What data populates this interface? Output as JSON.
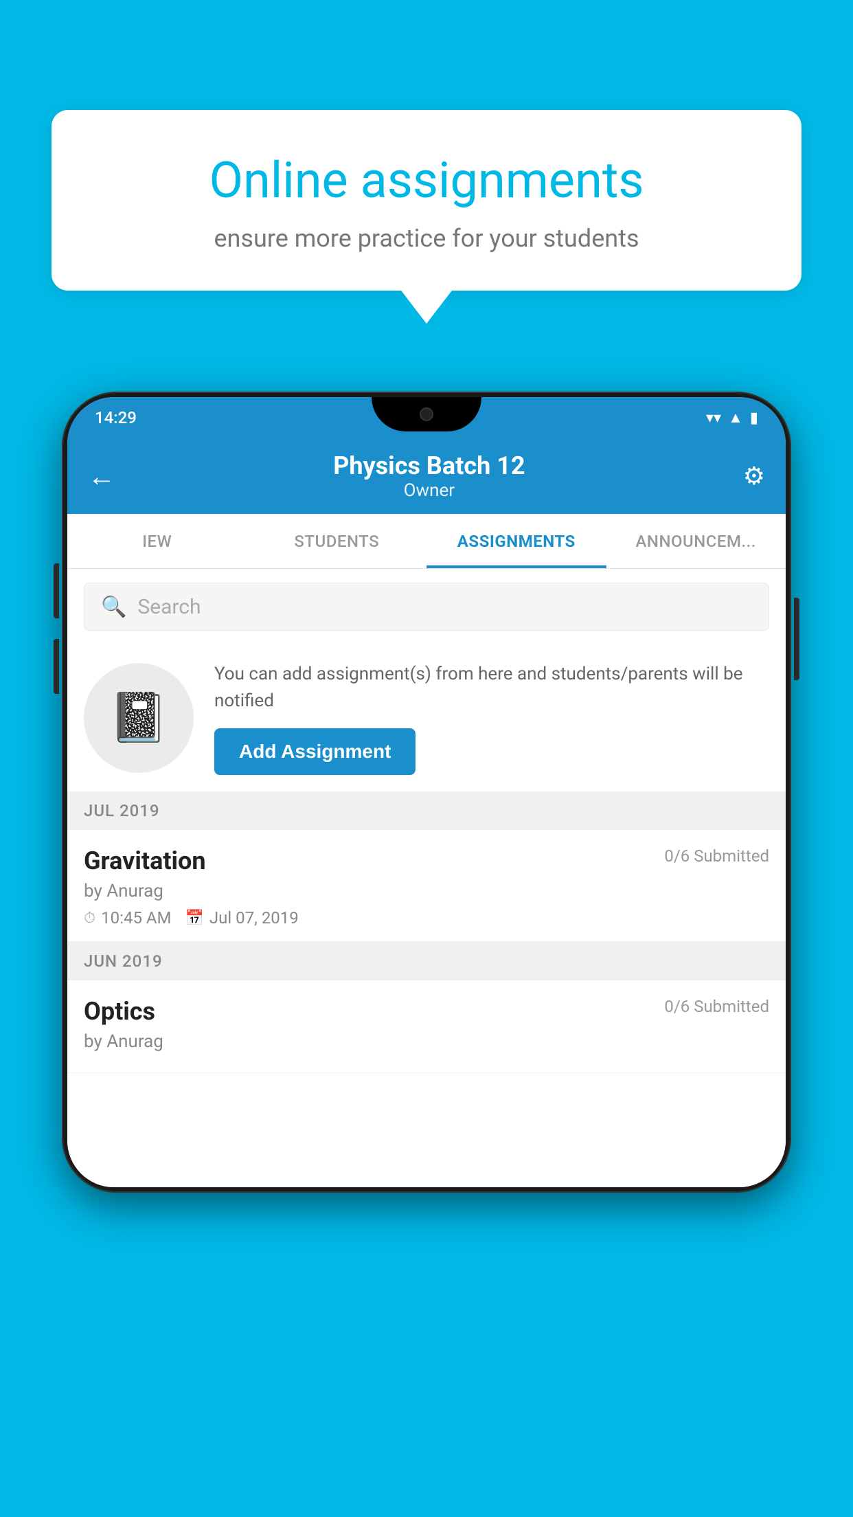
{
  "background": {
    "color": "#00b8e6"
  },
  "speech_bubble": {
    "title": "Online assignments",
    "subtitle": "ensure more practice for your students"
  },
  "phone": {
    "status_bar": {
      "time": "14:29",
      "icons": [
        "wifi",
        "signal",
        "battery"
      ]
    },
    "header": {
      "title": "Physics Batch 12",
      "subtitle": "Owner",
      "back_label": "←",
      "settings_label": "⚙"
    },
    "tabs": [
      {
        "label": "IEW",
        "active": false
      },
      {
        "label": "STUDENTS",
        "active": false
      },
      {
        "label": "ASSIGNMENTS",
        "active": true
      },
      {
        "label": "ANNOUNCEM...",
        "active": false
      }
    ],
    "search": {
      "placeholder": "Search"
    },
    "info_card": {
      "description": "You can add assignment(s) from here and students/parents will be notified",
      "button_label": "Add Assignment"
    },
    "month_sections": [
      {
        "month_label": "JUL 2019",
        "assignments": [
          {
            "title": "Gravitation",
            "submitted": "0/6 Submitted",
            "author": "by Anurag",
            "time": "10:45 AM",
            "date": "Jul 07, 2019"
          }
        ]
      },
      {
        "month_label": "JUN 2019",
        "assignments": [
          {
            "title": "Optics",
            "submitted": "0/6 Submitted",
            "author": "by Anurag",
            "time": "",
            "date": ""
          }
        ]
      }
    ]
  }
}
